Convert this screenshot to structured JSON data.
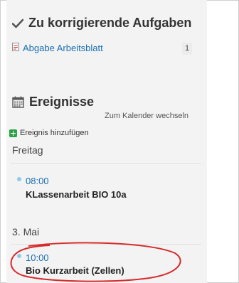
{
  "tasks": {
    "heading": "Zu korrigierende Aufgaben",
    "icon": "check-icon",
    "items": [
      {
        "label": "Abgabe Arbeitsblatt",
        "count": "1",
        "icon": "document-icon"
      }
    ]
  },
  "events": {
    "heading": "Ereignisse",
    "icon": "calendar-icon",
    "calendar_link": "Zum Kalender wechseln",
    "add_label": "Ereignis hinzufügen",
    "add_icon": "plus-icon",
    "days": [
      {
        "label": "Freitag",
        "items": [
          {
            "time": "08:00",
            "title": "KLassenarbeit BIO 10a"
          }
        ]
      },
      {
        "label": "3. Mai",
        "items": [
          {
            "time": "10:00",
            "title": "Bio Kurzarbeit (Zellen)"
          }
        ]
      }
    ]
  },
  "colors": {
    "link": "#1a6fb5",
    "panel_background": "#f3f3f3",
    "event_dot": "#8fc9ec",
    "add_button": "#2aa148",
    "highlight": "#d62c2c"
  }
}
